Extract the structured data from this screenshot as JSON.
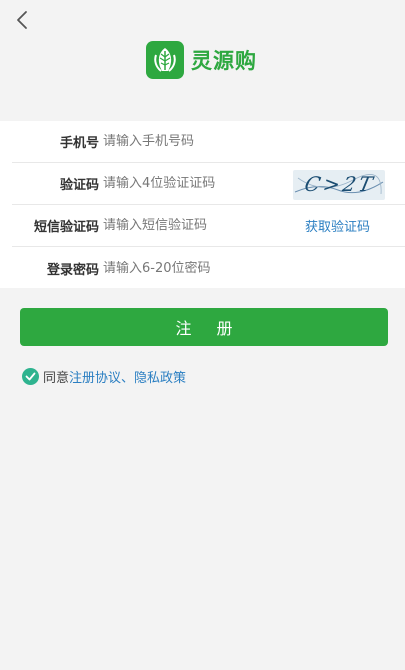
{
  "header": {
    "back_icon": "chevron-left-icon",
    "logo_text": "灵源购",
    "logo_icon": "leaf-icon"
  },
  "form": {
    "phone": {
      "label": "手机号",
      "placeholder": "请输入手机号码",
      "value": ""
    },
    "captcha": {
      "label": "验证码",
      "placeholder": "请输入4位验证证码",
      "image_text": "C>2T"
    },
    "sms": {
      "label": "短信验证码",
      "placeholder": "请输入短信验证码",
      "action": "获取验证码"
    },
    "password": {
      "label": "登录密码",
      "placeholder": "请输入6-20位密码",
      "value": ""
    }
  },
  "register_label": "注 册",
  "agreement": {
    "prefix": "同意",
    "link1": "注册协议",
    "separator": "、",
    "link2": "隐私政策",
    "checked": true
  },
  "colors": {
    "primary": "#2ea840",
    "link": "#2b7fc2",
    "check": "#2eb38f",
    "background": "#f3f3f3"
  }
}
